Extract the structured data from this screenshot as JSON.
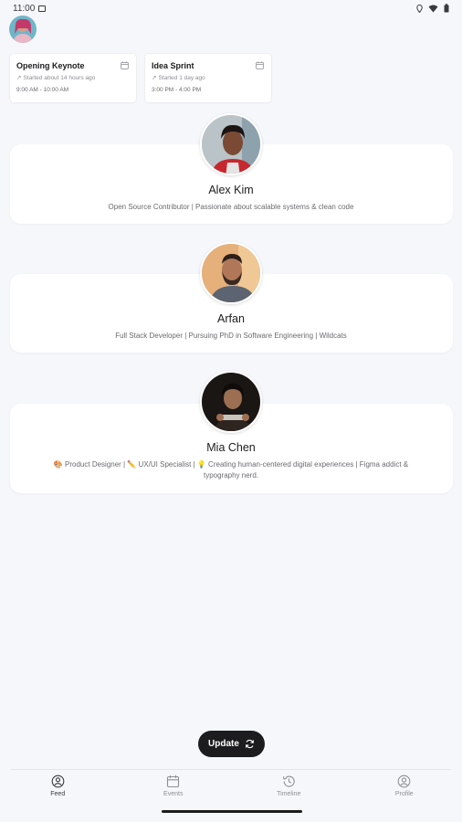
{
  "status_bar": {
    "time": "11:00"
  },
  "events": [
    {
      "title": "Opening Keynote",
      "started": "Started about 14 hours ago",
      "time": "9:00 AM - 10:00 AM"
    },
    {
      "title": "Idea Sprint",
      "started": "Started 1 day ago",
      "time": "3:00 PM - 4:00 PM"
    }
  ],
  "people": [
    {
      "name": "Alex Kim",
      "bio": "Open Source Contributor | Passionate about scalable systems & clean code"
    },
    {
      "name": "Arfan",
      "bio": "Full Stack Developer | Pursuing PhD in Software Engineering | Wildcats"
    },
    {
      "name": "Mia Chen",
      "bio_line1": "🎨 Product Designer | ✏️ UX/UI Specialist | 💡 Creating human-centered digital experiences | Figma addict &",
      "bio_line2": "typography nerd."
    }
  ],
  "update_button": {
    "label": "Update"
  },
  "nav": [
    {
      "label": "Feed",
      "icon": "feed-icon"
    },
    {
      "label": "Events",
      "icon": "calendar-icon"
    },
    {
      "label": "Timeline",
      "icon": "history-icon"
    },
    {
      "label": "Profile",
      "icon": "profile-icon"
    }
  ]
}
